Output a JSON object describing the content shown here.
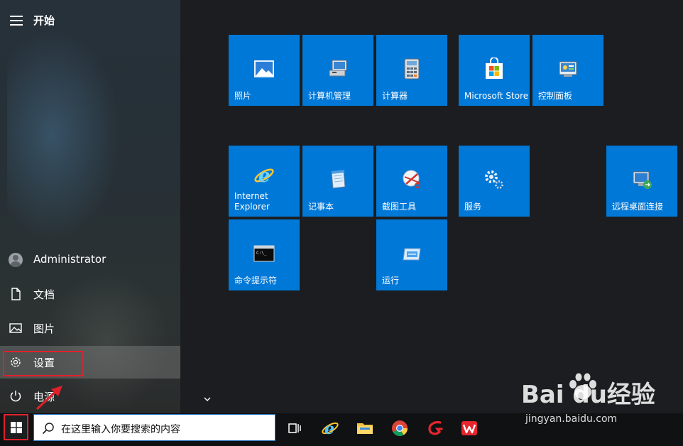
{
  "start_menu": {
    "title": "开始",
    "nav_items": [
      {
        "label": "Administrator",
        "icon": "user-avatar-icon"
      },
      {
        "label": "文档",
        "icon": "document-icon"
      },
      {
        "label": "图片",
        "icon": "picture-icon"
      },
      {
        "label": "设置",
        "icon": "gear-icon"
      },
      {
        "label": "电源",
        "icon": "power-icon"
      }
    ],
    "tiles": [
      {
        "label": "照片",
        "icon": "photos-icon"
      },
      {
        "label": "计算机管理",
        "icon": "computer-management-icon"
      },
      {
        "label": "计算器",
        "icon": "calculator-icon"
      },
      {
        "label": "Microsoft Store",
        "icon": "store-icon"
      },
      {
        "label": "控制面板",
        "icon": "control-panel-icon"
      },
      {
        "label": "Internet\nExplorer",
        "icon": "internet-explorer-icon"
      },
      {
        "label": "记事本",
        "icon": "notepad-icon"
      },
      {
        "label": "截图工具",
        "icon": "snipping-tool-icon"
      },
      {
        "label": "服务",
        "icon": "services-gear-icon"
      },
      {
        "label": "远程桌面连接",
        "icon": "remote-desktop-icon"
      },
      {
        "label": "命令提示符",
        "icon": "command-prompt-icon"
      },
      {
        "label": "运行",
        "icon": "run-icon"
      }
    ],
    "tile_color": "#0078d7",
    "highlight_color": "#e0212b"
  },
  "taskbar": {
    "search_placeholder": "在这里输入你要搜索的内容",
    "pinned": [
      "task-view-icon",
      "edge-browser-icon",
      "file-explorer-icon",
      "chrome-icon",
      "red-app-icon",
      "wps-office-icon"
    ]
  },
  "watermark": {
    "brand": "Bai  du经验",
    "url": "jingyan.baidu.com"
  }
}
